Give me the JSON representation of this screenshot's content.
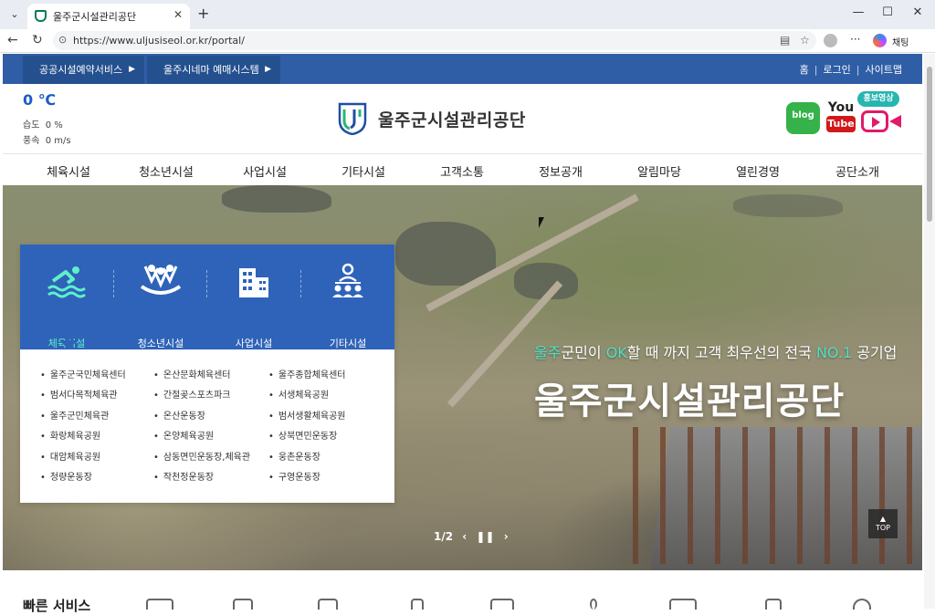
{
  "browser": {
    "tab_title": "울주군시설관리공단",
    "url": "https://www.uljusiseol.or.kr/portal/",
    "chat_label": "채팅"
  },
  "topstrip": {
    "btn1": "공공시설예약서비스",
    "btn2": "울주시네마 예매시스템",
    "links": [
      "홈",
      "로그인",
      "사이트맵"
    ]
  },
  "weather": {
    "temp": "0 ℃",
    "humidity_label": "습도",
    "humidity_value": "0 %",
    "wind_label": "풍속",
    "wind_value": "0 m/s"
  },
  "header": {
    "logo_text": "울주군시설관리공단",
    "blog_label": "blog",
    "yt_top": "You",
    "yt_bottom": "Tube",
    "promo_badge": "홍보영상"
  },
  "mainnav": [
    "체육시설",
    "청소년시설",
    "사업시설",
    "기타시설",
    "고객소통",
    "정보공개",
    "알림마당",
    "열린경영",
    "공단소개"
  ],
  "hero": {
    "sub_hl1": "울주",
    "sub_mid": "군민이 ",
    "sub_hl2": "OK",
    "sub_rest": "할 때 까지 고객 최우선의 전국 ",
    "sub_hl3": "NO.1",
    "sub_end": " 공기업",
    "title": "울주군시설관리공단",
    "pager": "1/2",
    "top_label": "TOP"
  },
  "facility_panel": {
    "categories": [
      {
        "label": "체육시설",
        "icon": "swimmer-icon",
        "active": true
      },
      {
        "label": "청소년시설",
        "icon": "youth-icon",
        "active": false
      },
      {
        "label": "사업시설",
        "icon": "building-icon",
        "active": false
      },
      {
        "label": "기타시설",
        "icon": "group-icon",
        "active": false
      }
    ],
    "col1": [
      "울주군국민체육센터",
      "범서다목적체육관",
      "울주군민체육관",
      "화랑체육공원",
      "대암체육공원",
      "청량운동장"
    ],
    "col2": [
      "온산문화체육센터",
      "간절곶스포츠파크",
      "온산운동장",
      "온양체육공원",
      "삼동면민운동장,체육관",
      "작천정운동장"
    ],
    "col3": [
      "울주종합체육센터",
      "서생체육공원",
      "범서생활체육공원",
      "상북면민운동장",
      "웅촌운동장",
      "구영운동장"
    ]
  },
  "bottom": {
    "title": "빠른 서비스"
  },
  "colors": {
    "brand_blue": "#2f5ea6",
    "panel_blue": "#2e63b9",
    "accent_teal": "#4fe0c4"
  }
}
